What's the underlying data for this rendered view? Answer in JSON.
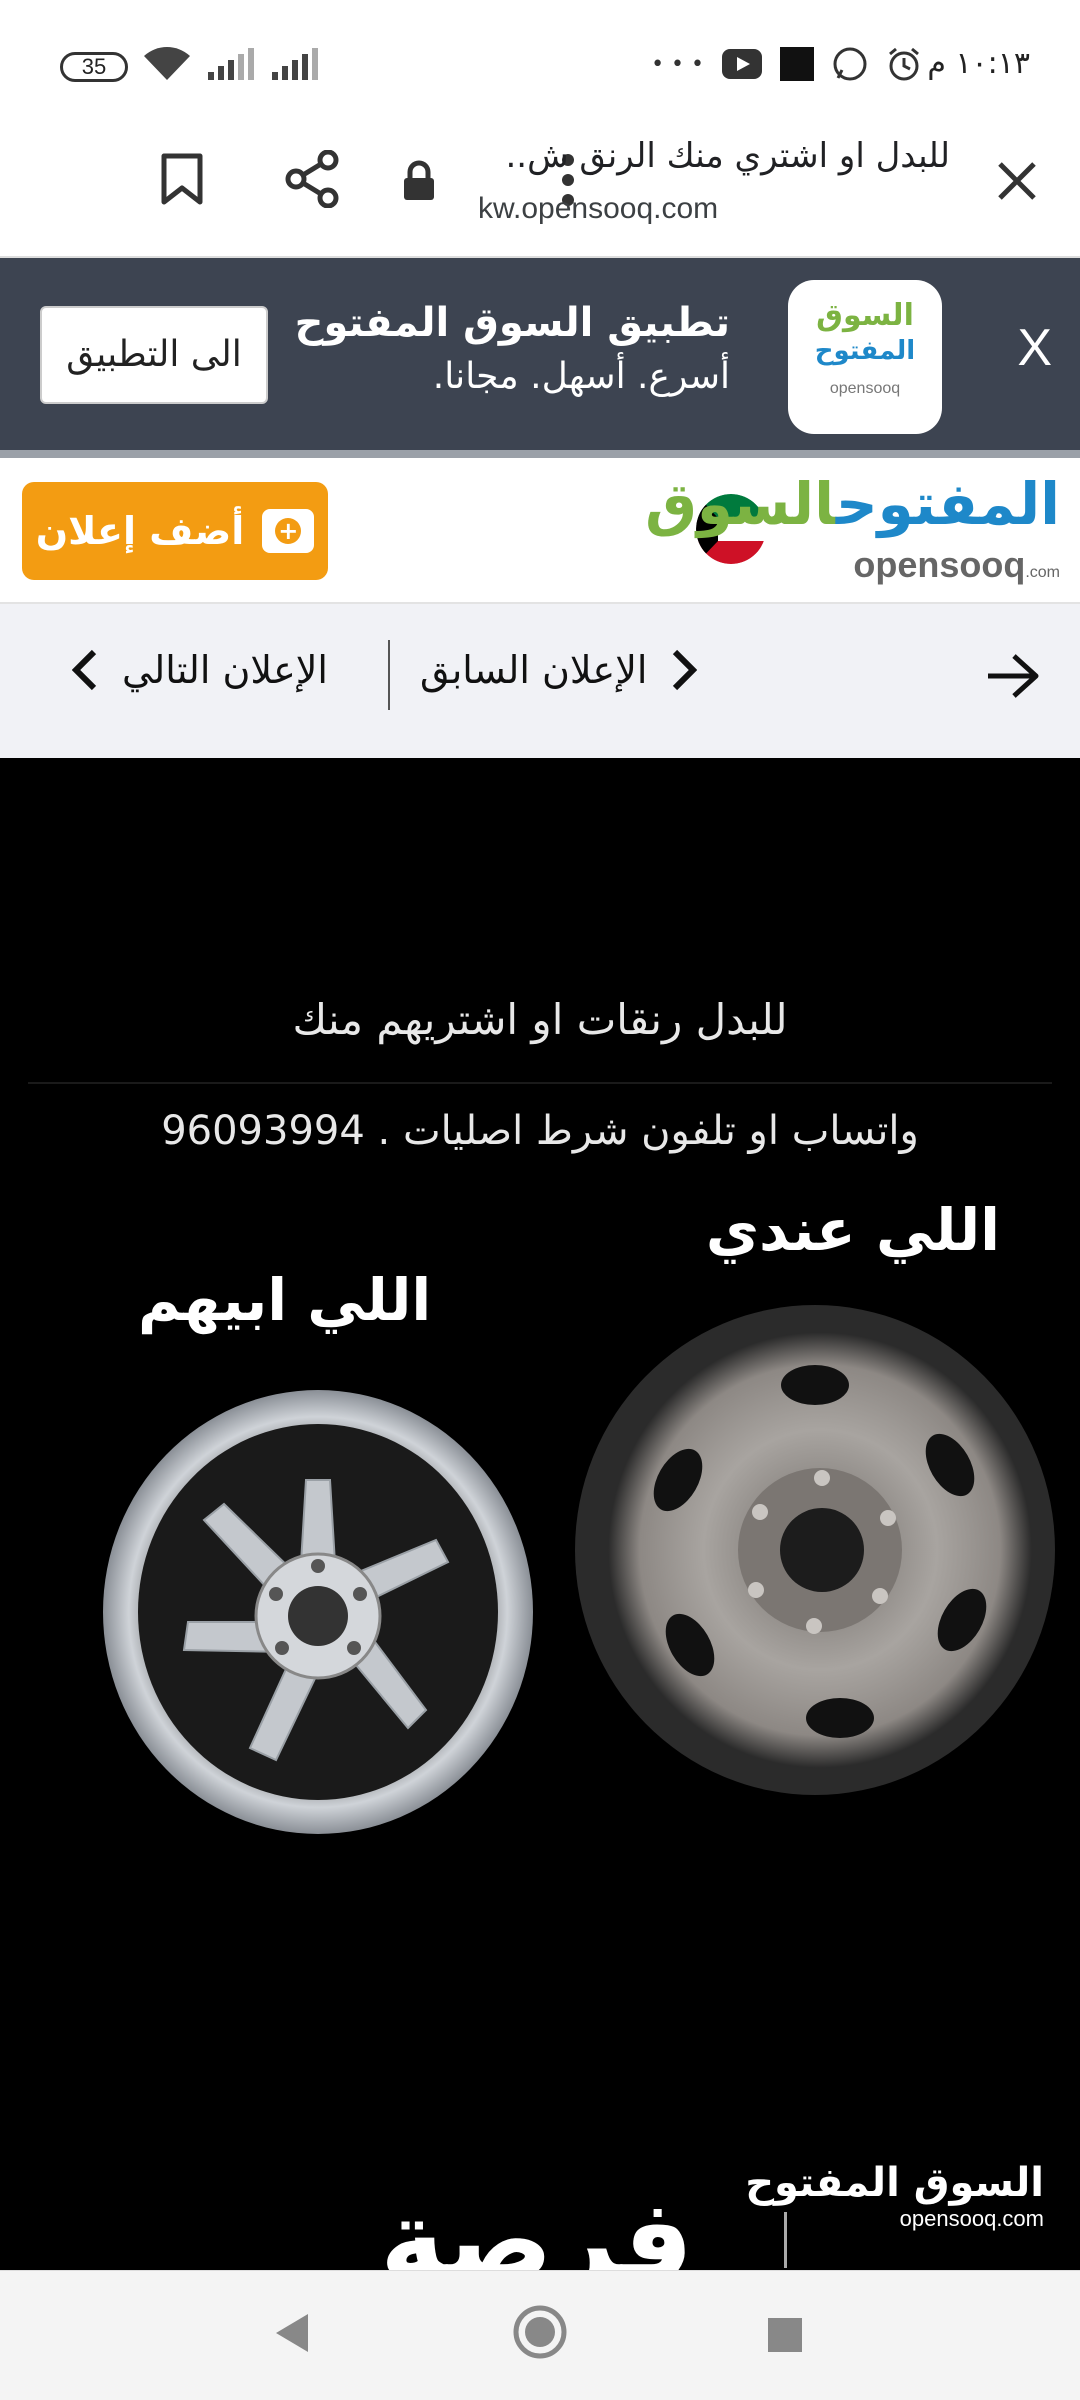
{
  "status_bar": {
    "time": "١٠:١٣ م",
    "battery_level": "35",
    "more_indicator": "• • •"
  },
  "url_bar": {
    "page_title": "للبدل او اشتري منك الرنق ش..",
    "domain": "kw.opensooq.com"
  },
  "app_banner": {
    "title": "تطبيق السوق المفتوح",
    "subtitle": "أسرع. أسهل. مجانا.",
    "button": "الى التطبيق",
    "close": "X",
    "logo_ar_top": "السوق",
    "logo_ar_bottom": "المفتوح",
    "logo_en": "opensooq"
  },
  "site_header": {
    "add_ad_button": "أضف إعلان",
    "logo_ar_part1": "السوق",
    "logo_ar_part2": "المفتوح",
    "logo_en": "opensooq",
    "logo_en_suffix": ".com"
  },
  "listing_nav": {
    "previous": "الإعلان السابق",
    "next": "الإعلان التالي"
  },
  "ad_image": {
    "line1": "للبدل رنقات او اشتريهم منك",
    "line2": "واتساب او تلفون شرط اصليات . 96093994",
    "label_have": "اللي عندي",
    "label_want": "اللي ابيهم",
    "overlay_text": "فرصة",
    "watermark_ar": "السوق المفتوح",
    "watermark_en": "opensooq.com"
  },
  "colors": {
    "brand_orange": "#f39c12",
    "brand_green": "#7cb342",
    "brand_blue": "#1e88c9",
    "banner_bg": "#3d4451"
  }
}
